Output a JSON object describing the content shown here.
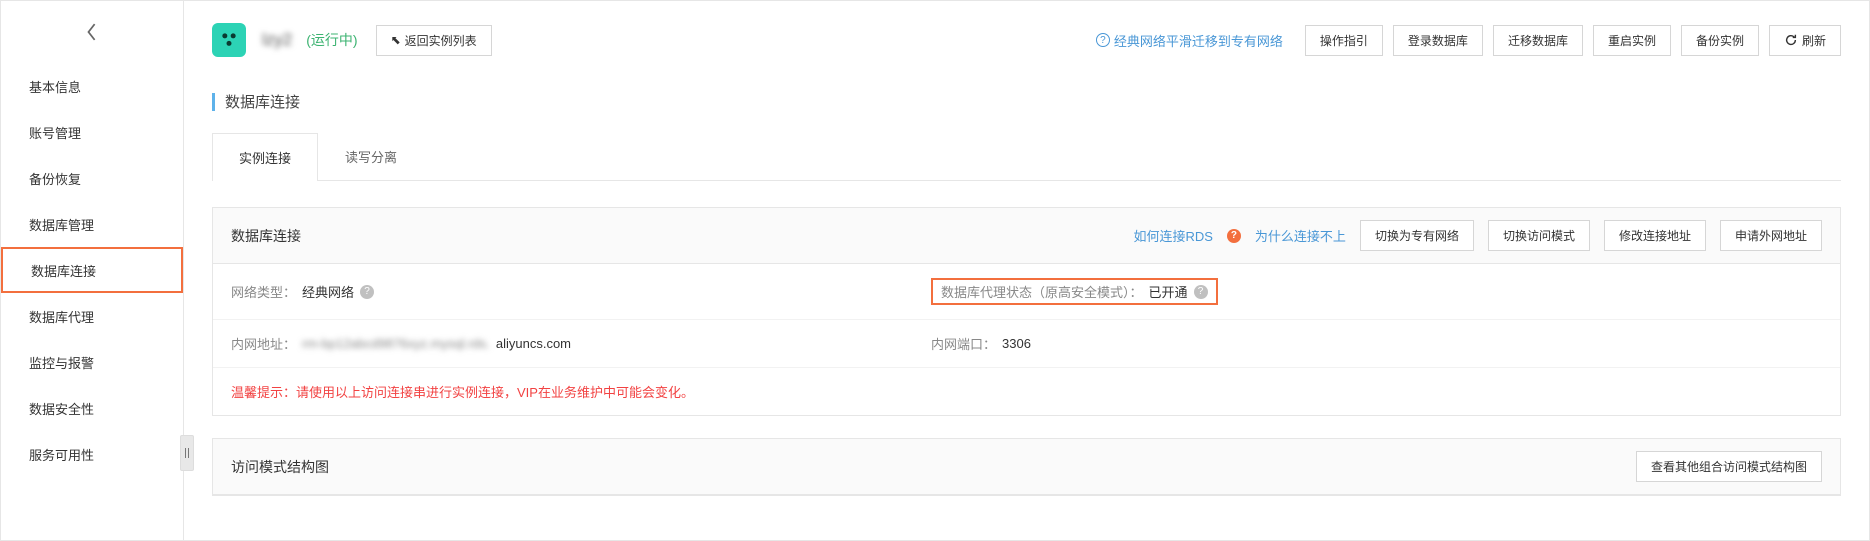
{
  "sidebar": {
    "items": [
      {
        "label": "基本信息"
      },
      {
        "label": "账号管理"
      },
      {
        "label": "备份恢复"
      },
      {
        "label": "数据库管理"
      },
      {
        "label": "数据库连接"
      },
      {
        "label": "数据库代理"
      },
      {
        "label": "监控与报警"
      },
      {
        "label": "数据安全性"
      },
      {
        "label": "服务可用性"
      }
    ]
  },
  "header": {
    "instance_name": "lzy2",
    "status": "(运行中)",
    "return_btn": "返回实例列表",
    "migrate_link": "经典网络平滑迁移到专有网络",
    "actions": {
      "guide": "操作指引",
      "login_db": "登录数据库",
      "migrate_db": "迁移数据库",
      "restart": "重启实例",
      "backup": "备份实例",
      "refresh": "刷新"
    }
  },
  "section": {
    "title": "数据库连接"
  },
  "tabs": {
    "conn": "实例连接",
    "rw": "读写分离"
  },
  "panel": {
    "title": "数据库连接",
    "how_connect": "如何连接RDS",
    "why_fail": "为什么连接不上",
    "switch_vpc": "切换为专有网络",
    "switch_mode": "切换访问模式",
    "edit_addr": "修改连接地址",
    "apply_public": "申请外网地址",
    "net_type_label": "网络类型：",
    "net_type_value": "经典网络",
    "proxy_status_label": "数据库代理状态（原高安全模式）：",
    "proxy_status_value": "已开通",
    "intranet_addr_label": "内网地址：",
    "intranet_addr_value_prefix": "rm-bp12abcd9876xyz.mysql.rds.",
    "intranet_addr_value_suffix": "aliyuncs.com",
    "intranet_port_label": "内网端口：",
    "intranet_port_value": "3306",
    "warning": "温馨提示：请使用以上访问连接串进行实例连接，VIP在业务维护中可能会变化。"
  },
  "panel2": {
    "title": "访问模式结构图",
    "view_other": "查看其他组合访问模式结构图"
  }
}
